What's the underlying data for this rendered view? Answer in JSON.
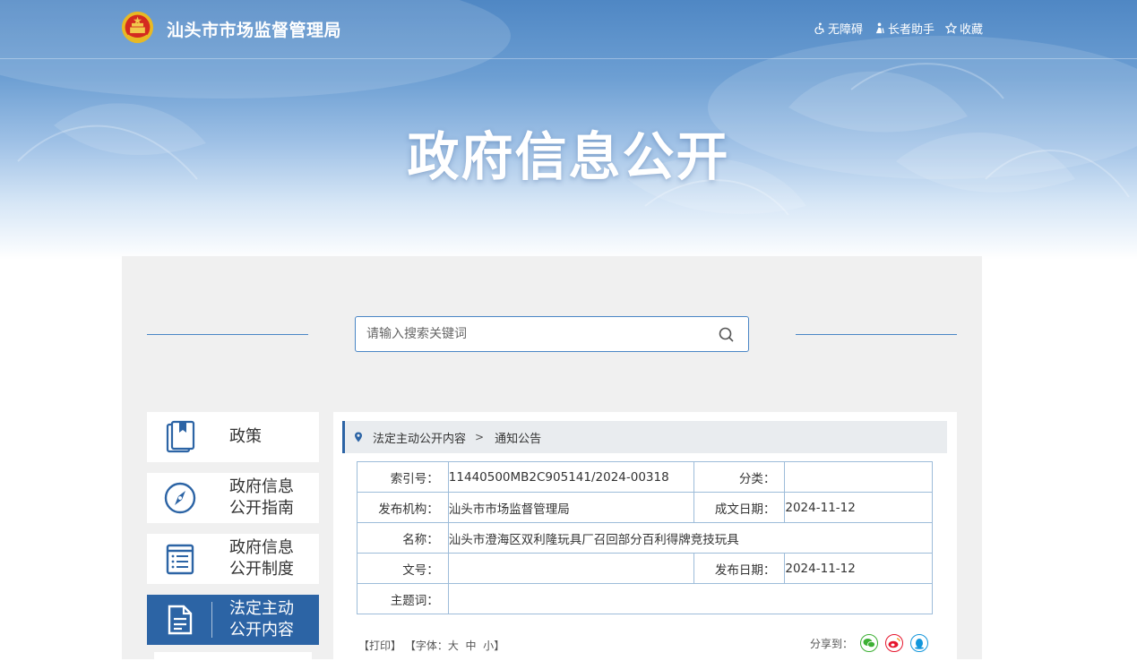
{
  "header": {
    "site_name": "汕头市市场监督管理局",
    "links": [
      {
        "label": "无障碍",
        "icon": "wheelchair-icon"
      },
      {
        "label": "长者助手",
        "icon": "elder-icon"
      },
      {
        "label": "收藏",
        "icon": "star-icon"
      }
    ]
  },
  "banner": {
    "title": "政府信息公开"
  },
  "search": {
    "placeholder": "请输入搜索关键词",
    "icon": "search-icon"
  },
  "sidebar": {
    "items": [
      {
        "label": "政策",
        "icon": "book-icon",
        "active": false
      },
      {
        "label": "政府信息\n公开指南",
        "icon": "compass-icon",
        "active": false
      },
      {
        "label": "政府信息\n公开制度",
        "icon": "list-doc-icon",
        "active": false
      },
      {
        "label": "法定主动\n公开内容",
        "icon": "document-icon",
        "active": true
      }
    ]
  },
  "breadcrumb": {
    "parent": "法定主动公开内容",
    "current": "通知公告"
  },
  "meta": {
    "index_label": "索引号：",
    "index_value": "11440500MB2C905141/2024-00318",
    "category_label": "分类：",
    "category_value": "",
    "publisher_label": "发布机构：",
    "publisher_value": "汕头市市场监督管理局",
    "created_label": "成文日期：",
    "created_value": "2024-11-12",
    "name_label": "名称：",
    "name_value": "汕头市澄海区双利隆玩具厂召回部分百利得牌竞技玩具",
    "docno_label": "文号：",
    "docno_value": "",
    "published_label": "发布日期：",
    "published_value": "2024-11-12",
    "keywords_label": "主题词：",
    "keywords_value": ""
  },
  "tools": {
    "print": "【打印】",
    "font_prefix": "【字体：",
    "large": "大",
    "medium": "中",
    "small": "小",
    "font_suffix": "】"
  },
  "share": {
    "label": "分享到：",
    "targets": [
      "wechat-icon",
      "weibo-icon",
      "qq-icon"
    ]
  },
  "colors": {
    "primary": "#2c64a5",
    "banner_top": "#4f87c4",
    "border": "#9dbcd9",
    "wechat": "#3cb034",
    "weibo": "#e6162d",
    "qq": "#1296db"
  }
}
